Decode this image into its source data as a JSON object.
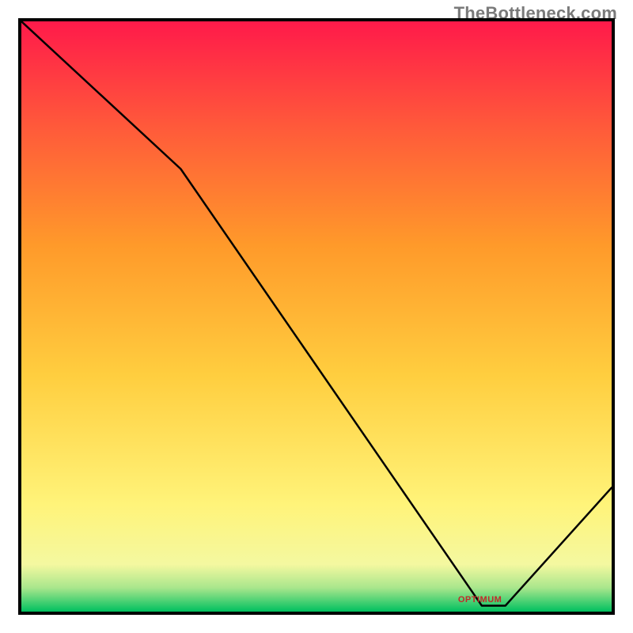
{
  "watermark": "TheBottleneck.com",
  "chart_data": {
    "type": "line",
    "title": "",
    "xlabel": "",
    "ylabel": "",
    "xlim": [
      0,
      100
    ],
    "ylim": [
      0,
      100
    ],
    "x": [
      0,
      27,
      78,
      82,
      100
    ],
    "values": [
      100,
      75,
      1,
      1,
      21
    ],
    "annotations": [
      {
        "text": "OPTIMUM",
        "x": 78,
        "y": 2
      }
    ],
    "background_gradient": {
      "direction": "bottom-to-top",
      "stops": [
        {
          "pos": 0.0,
          "color": "#00c060"
        },
        {
          "pos": 0.04,
          "color": "#a8e68c"
        },
        {
          "pos": 0.08,
          "color": "#f4f8a0"
        },
        {
          "pos": 0.18,
          "color": "#fff47a"
        },
        {
          "pos": 0.4,
          "color": "#ffce3f"
        },
        {
          "pos": 0.62,
          "color": "#ff9a2a"
        },
        {
          "pos": 0.82,
          "color": "#ff5a3a"
        },
        {
          "pos": 1.0,
          "color": "#ff1a4a"
        }
      ]
    }
  }
}
